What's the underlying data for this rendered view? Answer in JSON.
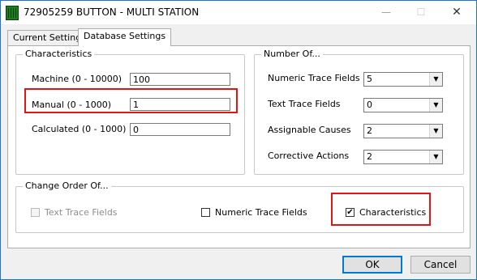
{
  "window": {
    "title": "72905259 BUTTON - MULTI STATION",
    "minimize_glyph": "—",
    "maximize_glyph": "☐",
    "close_glyph": "✕"
  },
  "tabs": [
    {
      "label": "Current Settings",
      "active": false
    },
    {
      "label": "Database Settings",
      "active": true
    }
  ],
  "characteristics": {
    "group_label": "Characteristics",
    "machine": {
      "label": "Machine (0 - 10000)",
      "value": "100"
    },
    "manual": {
      "label": "Manual (0 - 1000)",
      "value": "1"
    },
    "calculated": {
      "label": "Calculated (0 - 1000)",
      "value": "0"
    }
  },
  "number_of": {
    "group_label": "Number Of...",
    "numeric_trace_fields": {
      "label": "Numeric Trace Fields",
      "value": "5"
    },
    "text_trace_fields": {
      "label": "Text Trace Fields",
      "value": "0"
    },
    "assignable_causes": {
      "label": "Assignable Causes",
      "value": "2"
    },
    "corrective_actions": {
      "label": "Corrective Actions",
      "value": "2"
    }
  },
  "change_order": {
    "group_label": "Change Order Of...",
    "text_trace_fields": {
      "label": "Text Trace Fields",
      "checked": false,
      "enabled": false
    },
    "numeric_trace_fields": {
      "label": "Numeric Trace Fields",
      "checked": false,
      "enabled": true
    },
    "characteristics": {
      "label": "Characteristics",
      "checked": true,
      "enabled": true
    }
  },
  "buttons": {
    "ok": "OK",
    "cancel": "Cancel"
  },
  "check_glyph": "✔",
  "dropdown_glyph": "▼",
  "colors": {
    "highlight": "#e01616",
    "title_bar": "#ffffff",
    "accent": "#0078d7"
  }
}
